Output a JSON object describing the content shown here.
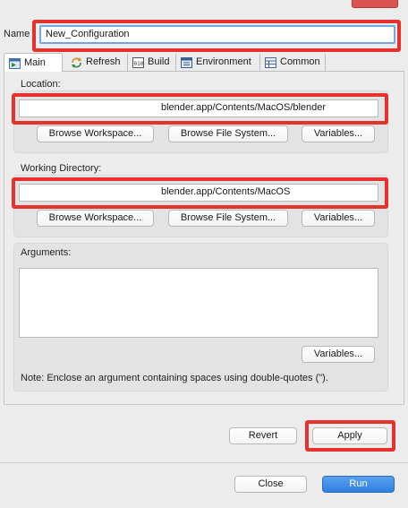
{
  "name_field": {
    "label": "Name",
    "value": "New_Configuration"
  },
  "tabs": [
    {
      "label": "Main",
      "icon": "main-icon"
    },
    {
      "label": "Refresh",
      "icon": "refresh-icon"
    },
    {
      "label": "Build",
      "icon": "build-icon"
    },
    {
      "label": "Environment",
      "icon": "environment-icon"
    },
    {
      "label": "Common",
      "icon": "common-icon"
    }
  ],
  "location": {
    "label": "Location:",
    "value": "blender.app/Contents/MacOS/blender",
    "browse_workspace": "Browse Workspace...",
    "browse_file_system": "Browse File System...",
    "variables": "Variables..."
  },
  "working_directory": {
    "label": "Working Directory:",
    "value": "blender.app/Contents/MacOS",
    "browse_workspace": "Browse Workspace...",
    "browse_file_system": "Browse File System...",
    "variables": "Variables..."
  },
  "arguments": {
    "label": "Arguments:",
    "value": "",
    "variables": "Variables...",
    "note": "Note: Enclose an argument containing spaces using double-quotes (\")."
  },
  "actions": {
    "revert": "Revert",
    "apply": "Apply"
  },
  "footer": {
    "close": "Close",
    "run": "Run"
  },
  "colors": {
    "highlight": "#e5322d",
    "run_button": "#2f7fe0",
    "focus_ring": "#6fa8e8"
  }
}
